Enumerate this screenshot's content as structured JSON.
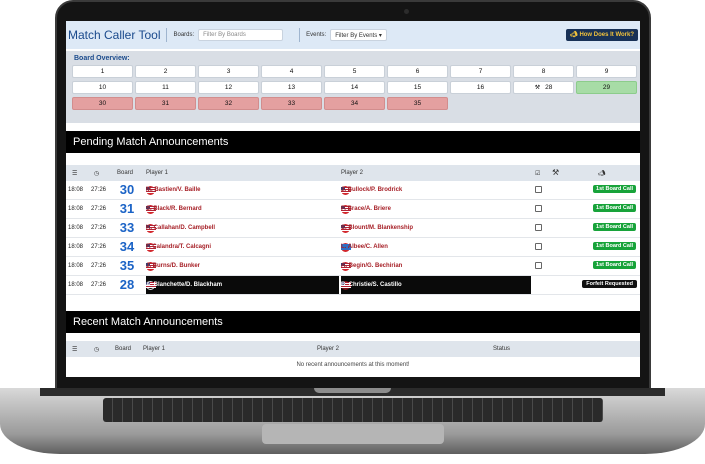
{
  "header": {
    "app_title": "Match Caller Tool",
    "boards_label": "Boards:",
    "boards_placeholder": "Filter By Boards",
    "events_label": "Events:",
    "events_value": "Filter By Events ▾",
    "help_button": "How Does It Work?"
  },
  "board_overview": {
    "title": "Board Overview:",
    "boards": [
      {
        "label": "1",
        "state": "free"
      },
      {
        "label": "2",
        "state": "free"
      },
      {
        "label": "3",
        "state": "free"
      },
      {
        "label": "4",
        "state": "free"
      },
      {
        "label": "5",
        "state": "free"
      },
      {
        "label": "6",
        "state": "free"
      },
      {
        "label": "7",
        "state": "free"
      },
      {
        "label": "8",
        "state": "free"
      },
      {
        "label": "9",
        "state": "free"
      },
      {
        "label": "10",
        "state": "free"
      },
      {
        "label": "11",
        "state": "free"
      },
      {
        "label": "12",
        "state": "free"
      },
      {
        "label": "13",
        "state": "free"
      },
      {
        "label": "14",
        "state": "free"
      },
      {
        "label": "15",
        "state": "free"
      },
      {
        "label": "16",
        "state": "free"
      },
      {
        "label": "28",
        "state": "free",
        "hammer": true
      },
      {
        "label": "29",
        "state": "green"
      },
      {
        "label": "30",
        "state": "red"
      },
      {
        "label": "31",
        "state": "red"
      },
      {
        "label": "32",
        "state": "red"
      },
      {
        "label": "33",
        "state": "red"
      },
      {
        "label": "34",
        "state": "red"
      },
      {
        "label": "35",
        "state": "red"
      }
    ]
  },
  "pending": {
    "title": "Pending Match Announcements",
    "columns": {
      "board": "Board",
      "player1": "Player 1",
      "player2": "Player 2"
    },
    "rows": [
      {
        "time": "18:08",
        "eta": "27:26",
        "board": "30",
        "p1": "M. Bastien/V. Baille",
        "p1_flag": "us",
        "p2": "J. Bullock/P. Brodrick",
        "p2_flag": "us",
        "action": "1st Board Call"
      },
      {
        "time": "18:08",
        "eta": "27:26",
        "board": "31",
        "p1": "S. Black/R. Bernard",
        "p1_flag": "us",
        "p2": "P. Brace/A. Briere",
        "p2_flag": "us",
        "action": "1st Board Call"
      },
      {
        "time": "18:08",
        "eta": "27:26",
        "board": "33",
        "p1": "K. Callahan/D. Campbell",
        "p1_flag": "us",
        "p2": "S. Blount/M. Blankenship",
        "p2_flag": "us",
        "action": "1st Board Call"
      },
      {
        "time": "18:08",
        "eta": "27:26",
        "board": "34",
        "p1": "F. Calandra/T. Calcagni",
        "p1_flag": "us",
        "p2": "L. Albee/C. Allen",
        "p2_flag": "blue",
        "action": "1st Board Call"
      },
      {
        "time": "18:08",
        "eta": "27:26",
        "board": "35",
        "p1": "J. Burns/D. Bunker",
        "p1_flag": "us",
        "p2": "A. Begin/G. Bechirian",
        "p2_flag": "us",
        "action": "1st Board Call"
      },
      {
        "time": "18:08",
        "eta": "27:26",
        "board": "28",
        "p1": "A. Blanchette/D. Blackham",
        "p1_flag": "us",
        "p2": "B. Christie/S. Castillo",
        "p2_flag": "us",
        "action": "Forfeit Requested",
        "dark": true
      }
    ]
  },
  "recent": {
    "title": "Recent Match Announcements",
    "columns": {
      "board": "Board",
      "player1": "Player 1",
      "player2": "Player 2",
      "status": "Status"
    },
    "empty_message": "No recent announcements at this moment!"
  },
  "colors": {
    "accent": "#1a4a8c",
    "board_number": "#1b63c6",
    "call_green": "#18a33a",
    "player_red": "#a61f26"
  }
}
